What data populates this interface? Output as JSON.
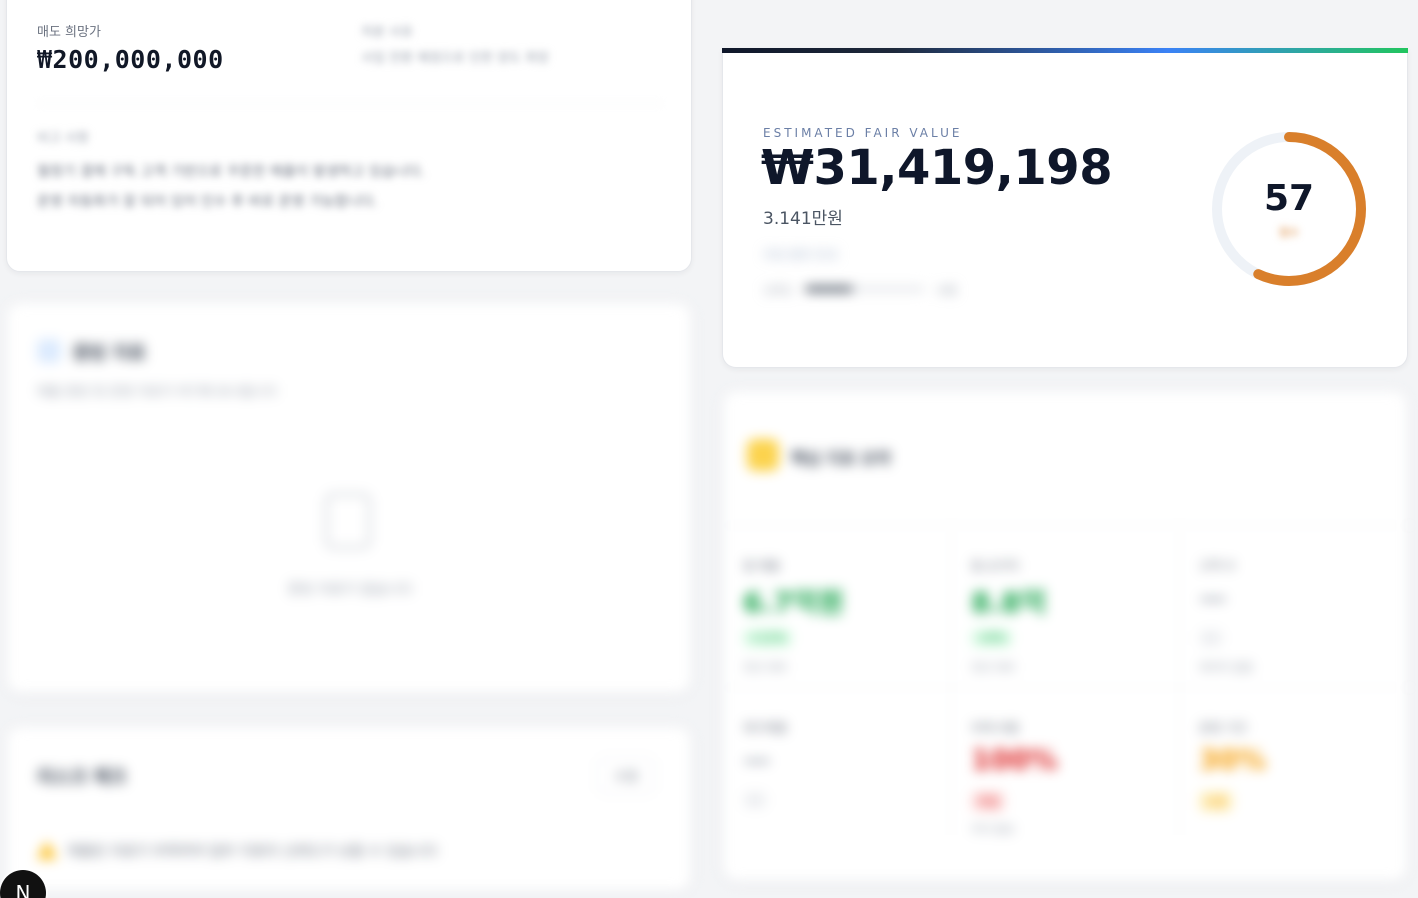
{
  "price_card": {
    "sale_price_label": "매도 희망가",
    "sale_price": "₩200,000,000",
    "side_label": "처분 사유",
    "side_text": "사업 전환 예정으로 인한 양도 희망",
    "side_text2": "",
    "memo_label": "비고 사항",
    "memo_line1": "월정기 결제 구독 고객 기반으로 꾸준한 매출이 발생하고 있습니다.",
    "memo_line2": "운영 자동화가 잘 되어 있어 인수 후 바로 운영 가능합니다."
  },
  "value_card": {
    "eyebrow": "ESTIMATED FAIR VALUE",
    "value": "₩31,419,198",
    "value_sub": "3.141만원",
    "range_text": "추정 범위 안내",
    "confidence_label": "신뢰도",
    "confidence_level": "보통",
    "score": "57",
    "score_caption": "점수",
    "score_fraction": 0.57,
    "score_color": "#d97f2b"
  },
  "docs_card": {
    "title": "증빙 자료",
    "subtitle": "매출 증빙 및 운영 자료가 여기에 표시됩니다",
    "empty_text": "증빙 자료가 없습니다"
  },
  "warn_card": {
    "title": "리스크 체크",
    "button": "수정",
    "warning": "제출된 자료가 부족하여 일부 지표의 신뢰도가 낮을 수 있습니다"
  },
  "metrics_card": {
    "title": "핵심 지표 요약",
    "cells": [
      {
        "label": "월 매출",
        "value": "6.7억원",
        "pill": "+12%",
        "foot": "전년 대비",
        "color": "#16a34a",
        "pill_bg": "#dcfce7"
      },
      {
        "label": "월 순이익",
        "value": "8.8억",
        "pill": "+8%",
        "foot": "전년 대비",
        "color": "#16a34a",
        "pill_bg": "#dcfce7"
      },
      {
        "label": "고객 수",
        "value": "—",
        "pill": "—",
        "foot": "데이터 없음",
        "color": "#9ca3af",
        "pill_bg": "#f3f4f6"
      },
      {
        "label": "재구매율",
        "value": "—",
        "pill": "—",
        "foot": "",
        "color": "#9ca3af",
        "pill_bg": "#f3f4f6"
      },
      {
        "label": "부채 비율",
        "value": "100%",
        "pill": "위험",
        "foot": "주의 필요",
        "color": "#dc2626",
        "pill_bg": "#fee2e2"
      },
      {
        "label": "운영 기간",
        "value": "30%",
        "pill": "보통",
        "foot": "",
        "color": "#f59e0b",
        "pill_bg": "#fef3c7"
      }
    ]
  },
  "badge": {
    "letter": "N"
  }
}
